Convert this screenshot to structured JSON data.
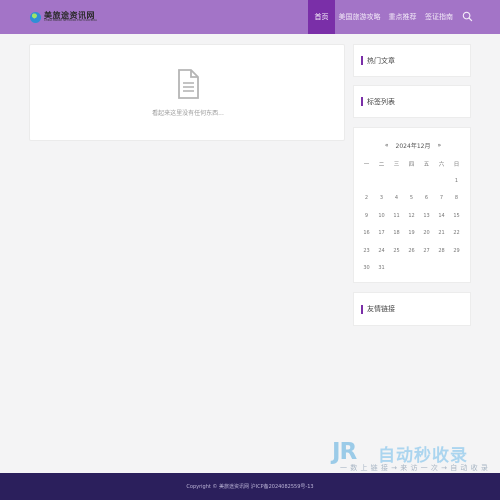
{
  "header": {
    "logo_title": "美旅途资讯网",
    "logo_subtitle": "CHINA BRAND NETWORK ENCYCLOPEDIA",
    "nav": [
      {
        "label": "首页",
        "active": true
      },
      {
        "label": "美国旅游攻略",
        "active": false
      },
      {
        "label": "重点推荐",
        "active": false
      },
      {
        "label": "签证指南",
        "active": false
      }
    ],
    "search_icon": "search-icon"
  },
  "main": {
    "empty_icon": "document-icon",
    "empty_message": "看起来这里没有任何东西..."
  },
  "sidebar": {
    "hot_title": "热门文章",
    "tags_title": "标签列表",
    "links_title": "友情链接",
    "calendar": {
      "month_label": "2024年12月",
      "prev": "«",
      "next": "»",
      "weekdays": [
        "一",
        "二",
        "三",
        "四",
        "五",
        "六",
        "日"
      ],
      "weeks": [
        [
          "",
          "",
          "",
          "",
          "",
          "",
          "1"
        ],
        [
          "2",
          "3",
          "4",
          "5",
          "6",
          "7",
          "8"
        ],
        [
          "9",
          "10",
          "11",
          "12",
          "13",
          "14",
          "15"
        ],
        [
          "16",
          "17",
          "18",
          "19",
          "20",
          "21",
          "22"
        ],
        [
          "23",
          "24",
          "25",
          "26",
          "27",
          "28",
          "29"
        ],
        [
          "30",
          "31",
          "",
          "",
          "",
          "",
          ""
        ]
      ]
    }
  },
  "footer": {
    "text": "Copyright © 美旅途资讯网 沪ICP备2024082559号-13"
  },
  "watermark": {
    "logo": "JR",
    "main": "自动秒收录",
    "sub": "一 数 上 链 接 → 来 访 一 次 → 自 动 收 录 一"
  },
  "colors": {
    "header_bg": "#a374c7",
    "nav_active_bg": "#7a2fa8",
    "footer_bg": "#2b1f5c",
    "accent": "#7a2fa8"
  }
}
